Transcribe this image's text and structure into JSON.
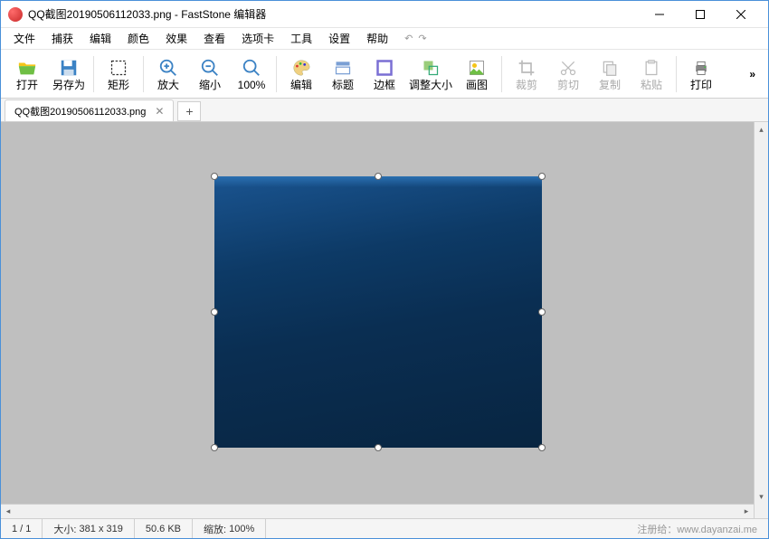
{
  "titlebar": {
    "title": "QQ截图20190506112033.png - FastStone 编辑器"
  },
  "menu": {
    "items": [
      "文件",
      "捕获",
      "编辑",
      "颜色",
      "效果",
      "查看",
      "选项卡",
      "工具",
      "设置",
      "帮助"
    ]
  },
  "toolbar": {
    "open": "打开",
    "saveas": "另存为",
    "rect": "矩形",
    "zoomin": "放大",
    "zoomout": "缩小",
    "zoom100": "100%",
    "edit": "编辑",
    "title": "标题",
    "border": "边框",
    "resize": "调整大小",
    "draw": "画图",
    "crop": "裁剪",
    "cut": "剪切",
    "copy": "复制",
    "paste": "粘贴",
    "print": "打印"
  },
  "tab": {
    "label": "QQ截图20190506112033.png"
  },
  "status": {
    "page": "1 / 1",
    "size_label": "大小:",
    "size_value": "381 x 319",
    "filesize": "50.6 KB",
    "zoom_label": "缩放:",
    "zoom_value": "100%",
    "watermark": "注册给：www.dayanzai.me"
  }
}
